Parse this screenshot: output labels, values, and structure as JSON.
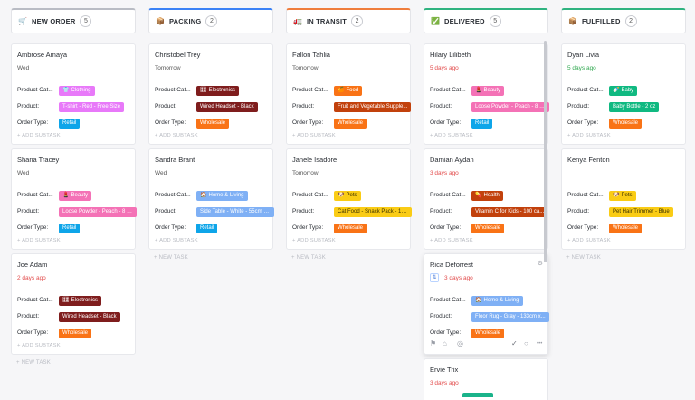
{
  "board": {
    "new_task_label": "+ NEW TASK",
    "add_subtask_label": "+ ADD SUBTASK",
    "field_labels": {
      "category": "Product Cat...",
      "product": "Product:",
      "order_type": "Order Type:"
    }
  },
  "colors": {
    "new_order": "#b9bcc4",
    "packing": "#3b82f6",
    "in_transit": "#ef7d3c",
    "delivered": "#2fb380",
    "fulfilled": "#2fb380",
    "category": {
      "clothing": "#e879f9",
      "electronics": "#7f1d1d",
      "food": "#f97316",
      "beauty": "#f472b6",
      "home_living": "#7fb0f5",
      "pets": "#facc15",
      "health": "#c2410c",
      "baby": "#10b981"
    },
    "order_type": {
      "retail": "#0ea5e9",
      "wholesale": "#f97316"
    }
  },
  "columns": [
    {
      "title": "NEW ORDER",
      "count": "5",
      "icon": "cart-icon",
      "glyph": "🛒",
      "color": "#b9bcc4",
      "cards": [
        {
          "title": "Ambrose Amaya",
          "date": "Wed",
          "date_style": "",
          "category": {
            "glyph": "👕",
            "label": "Clothing",
            "color": "#e879f9"
          },
          "product": {
            "label": "T-shirt - Red - Free Size",
            "color": "#e879f9"
          },
          "order_type": {
            "label": "Retail",
            "color": "#0ea5e9"
          }
        },
        {
          "title": "Shana Tracey",
          "date": "Wed",
          "date_style": "",
          "category": {
            "glyph": "💄",
            "label": "Beauty",
            "color": "#f472b6"
          },
          "product": {
            "label": "Loose Powder - Peach - 8 g...",
            "color": "#f472b6"
          },
          "order_type": {
            "label": "Retail",
            "color": "#0ea5e9"
          }
        },
        {
          "title": "Joe Adam",
          "date": "2 days ago",
          "date_style": "red",
          "category": {
            "glyph": "🎛",
            "label": "Electronics",
            "color": "#7f1d1d"
          },
          "product": {
            "label": "Wired Headset - Black",
            "color": "#7f1d1d"
          },
          "order_type": {
            "label": "Wholesale",
            "color": "#f97316"
          }
        }
      ]
    },
    {
      "title": "PACKING",
      "count": "2",
      "icon": "package-icon",
      "glyph": "📦",
      "color": "#3b82f6",
      "cards": [
        {
          "title": "Christobel Trey",
          "date": "Tomorrow",
          "date_style": "",
          "category": {
            "glyph": "🎛",
            "label": "Electronics",
            "color": "#7f1d1d"
          },
          "product": {
            "label": "Wired Headset - Black",
            "color": "#7f1d1d"
          },
          "order_type": {
            "label": "Wholesale",
            "color": "#f97316"
          }
        },
        {
          "title": "Sandra Brant",
          "date": "Wed",
          "date_style": "",
          "category": {
            "glyph": "🏠",
            "label": "Home & Living",
            "color": "#7fb0f5"
          },
          "product": {
            "label": "Side Table - White - 55cm x...",
            "color": "#7fb0f5"
          },
          "order_type": {
            "label": "Retail",
            "color": "#0ea5e9"
          }
        }
      ]
    },
    {
      "title": "IN TRANSIT",
      "count": "2",
      "icon": "truck-icon",
      "glyph": "🚛",
      "color": "#ef7d3c",
      "cards": [
        {
          "title": "Fallon Tahlia",
          "date": "Tomorrow",
          "date_style": "",
          "category": {
            "glyph": "🍊",
            "label": "Food",
            "color": "#f97316"
          },
          "product": {
            "label": "Fruit and Vegetable Supple...",
            "color": "#c2410c"
          },
          "order_type": {
            "label": "Wholesale",
            "color": "#f97316"
          }
        },
        {
          "title": "Janele Isadore",
          "date": "Tomorrow",
          "date_style": "",
          "category": {
            "glyph": "🐶",
            "label": "Pets",
            "color": "#facc15"
          },
          "product": {
            "label": "Cat Food - Snack Pack - 10...",
            "color": "#facc15"
          },
          "order_type": {
            "label": "Wholesale",
            "color": "#f97316"
          }
        }
      ]
    },
    {
      "title": "DELIVERED",
      "count": "5",
      "icon": "checkbox-icon",
      "glyph": "✅",
      "color": "#2fb380",
      "cards": [
        {
          "title": "Hilary Lilibeth",
          "date": "5 days ago",
          "date_style": "red",
          "category": {
            "glyph": "💄",
            "label": "Beauty",
            "color": "#f472b6"
          },
          "product": {
            "label": "Loose Powder - Peach - 8 g...",
            "color": "#f472b6"
          },
          "order_type": {
            "label": "Retail",
            "color": "#0ea5e9"
          }
        },
        {
          "title": "Damian Aydan",
          "date": "3 days ago",
          "date_style": "red",
          "category": {
            "glyph": "💊",
            "label": "Health",
            "color": "#c2410c"
          },
          "product": {
            "label": "Vitamin C for Kids - 100 ca...",
            "color": "#c2410c"
          },
          "order_type": {
            "label": "Wholesale",
            "color": "#f97316"
          }
        },
        {
          "title": "Rica Deforrest",
          "date": "3 days ago",
          "date_style": "red",
          "hover": true,
          "category": {
            "glyph": "🏠",
            "label": "Home & Living",
            "color": "#7fb0f5"
          },
          "product": {
            "label": "Floor Rug - Gray - 133cm x...",
            "color": "#7fb0f5"
          },
          "order_type": {
            "label": "Wholesale",
            "color": "#f97316"
          }
        },
        {
          "title": "Ervie Trix",
          "date": "3 days ago",
          "date_style": "red",
          "peek": true
        }
      ]
    },
    {
      "title": "FULFILLED",
      "count": "2",
      "icon": "package-icon",
      "glyph": "📦",
      "color": "#2fb380",
      "cards": [
        {
          "title": "Dyan Livia",
          "date": "5 days ago",
          "date_style": "green",
          "category": {
            "glyph": "🍼",
            "label": "Baby",
            "color": "#10b981"
          },
          "product": {
            "label": "Baby Bottle - 2 oz",
            "color": "#10b981"
          },
          "order_type": {
            "label": "Wholesale",
            "color": "#f97316"
          }
        },
        {
          "title": "Kenya Fenton",
          "date": "",
          "date_style": "",
          "category": {
            "glyph": "🐶",
            "label": "Pets",
            "color": "#facc15"
          },
          "product": {
            "label": "Pet Hair Trimmer - Blue",
            "color": "#facc15"
          },
          "order_type": {
            "label": "Wholesale",
            "color": "#f97316"
          }
        }
      ]
    }
  ]
}
